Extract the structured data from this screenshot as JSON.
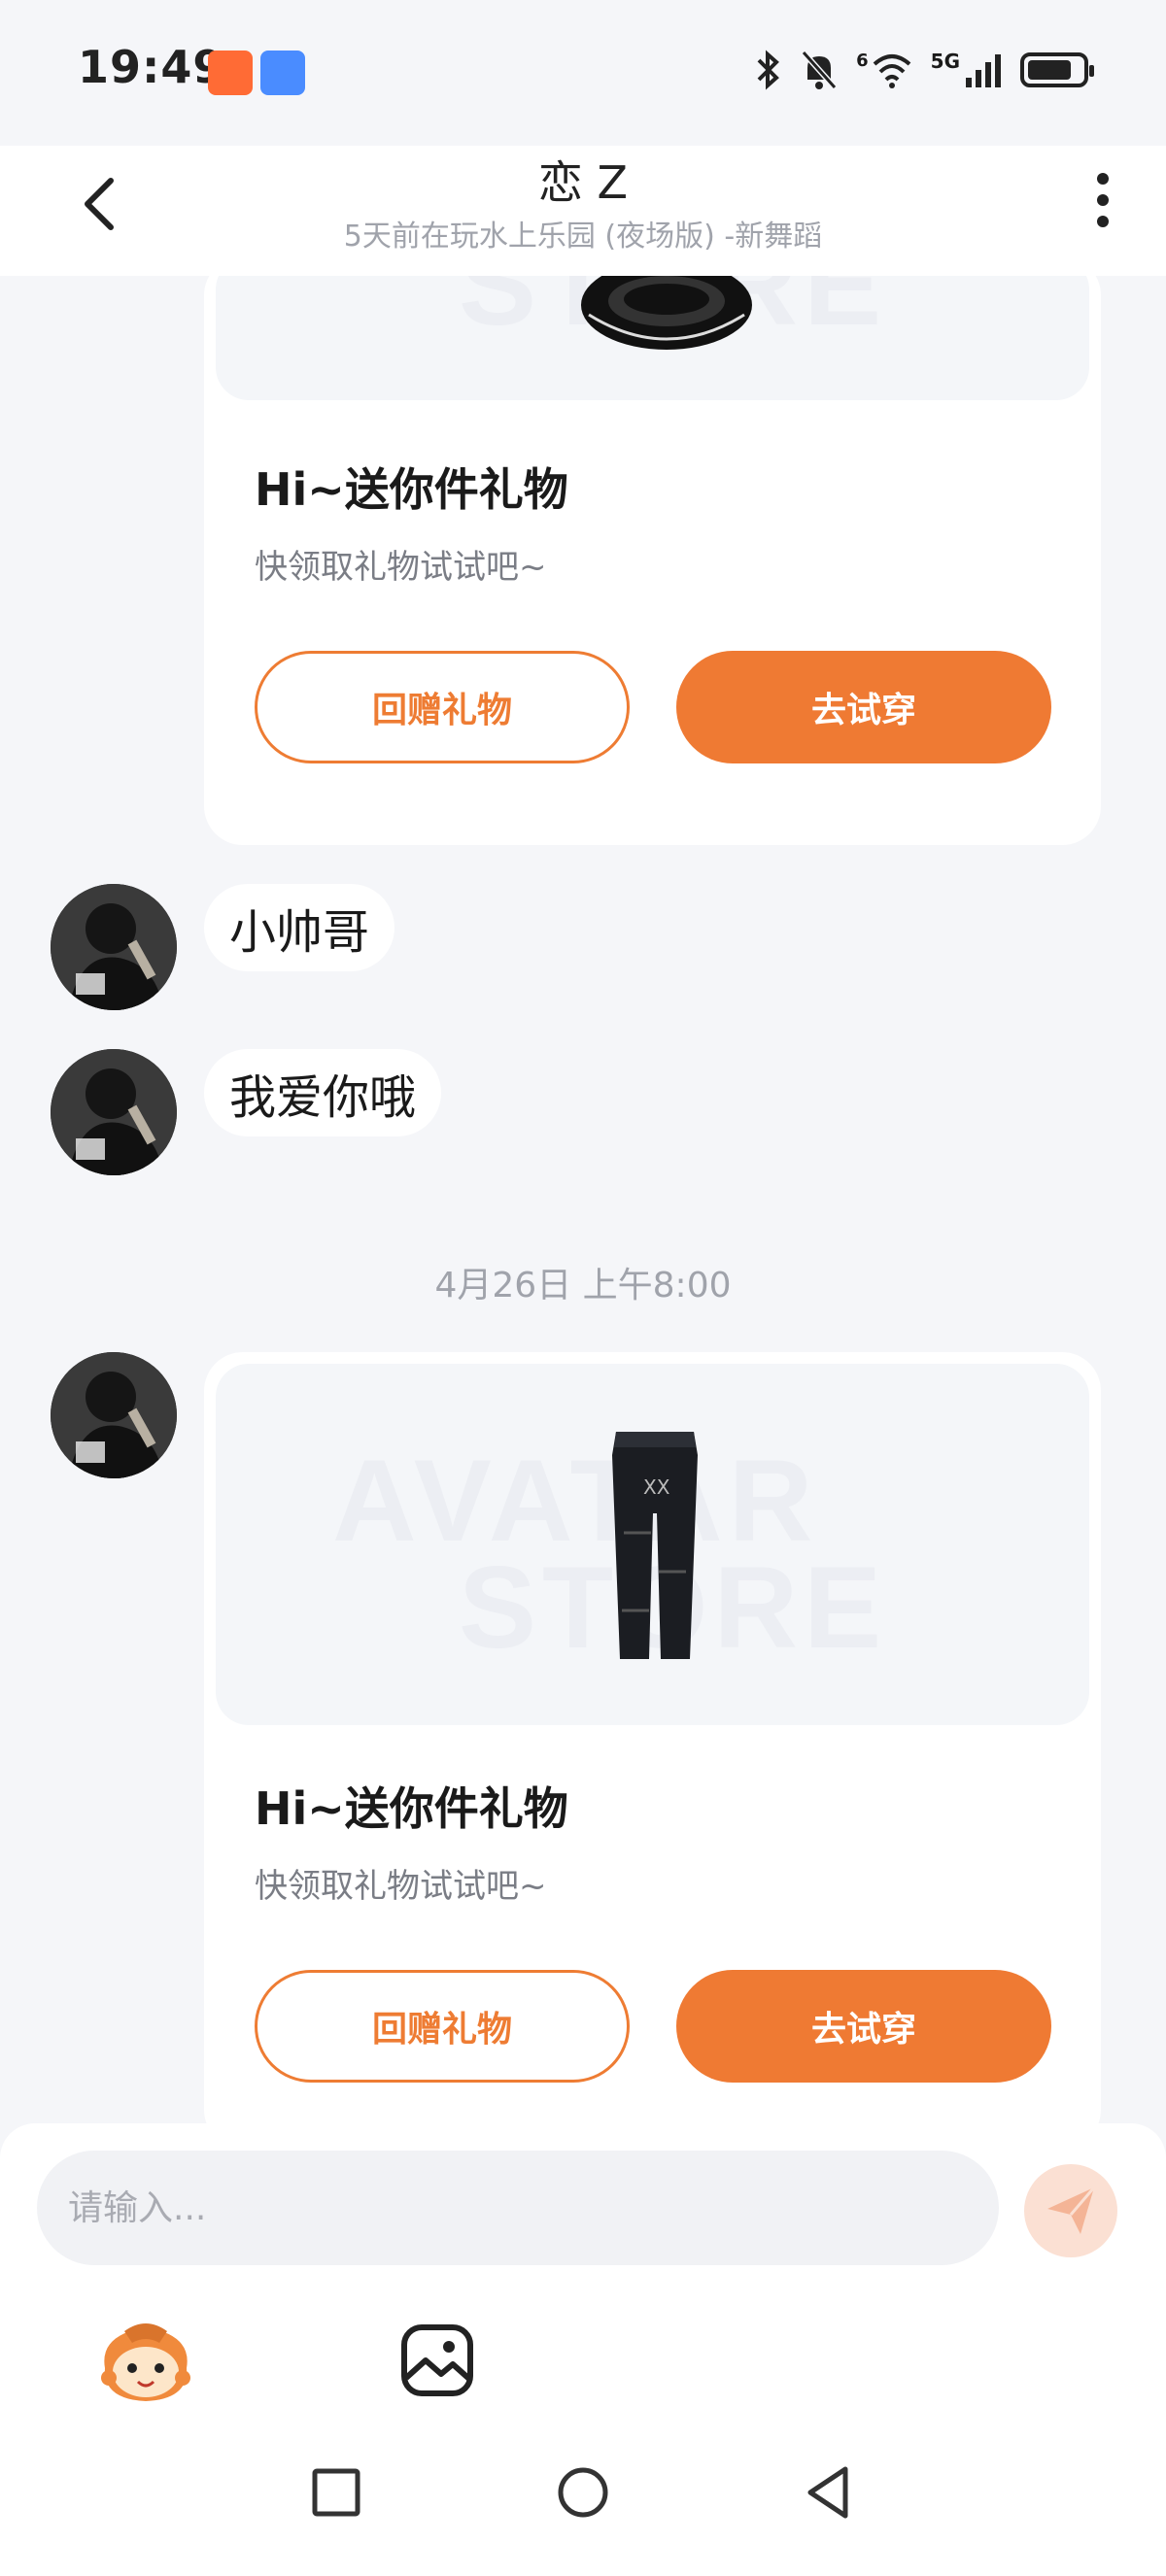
{
  "status_bar": {
    "time": "19:49",
    "signal_label": "5G",
    "sim_label": "6",
    "battery_level": 0.7
  },
  "header": {
    "name": "恋 Z",
    "subtitle": "5天前在玩水上乐园 (夜场版) -新舞蹈"
  },
  "watermark": {
    "line1": "AVATAR",
    "line2": "STORE"
  },
  "messages": {
    "card1": {
      "title": "Hi~送你件礼物",
      "subtitle": "快领取礼物试试吧~",
      "return_gift": "回赠礼物",
      "try_on": "去试穿"
    },
    "bubble1": "小帅哥",
    "bubble2": "我爱你哦",
    "timestamp": "4月26日 上午8:00",
    "card2": {
      "title": "Hi~送你件礼物",
      "subtitle": "快领取礼物试试吧~",
      "return_gift": "回赠礼物",
      "try_on": "去试穿"
    }
  },
  "input": {
    "placeholder": "请输入..."
  },
  "icons": {
    "back": "chevron-left-icon",
    "more": "more-vertical-icon",
    "send": "send-icon",
    "emoji": "emoji-avatar-icon",
    "image": "image-icon"
  },
  "colors": {
    "accent": "#ef7a33",
    "background": "#f5f6f9",
    "card": "#ffffff"
  }
}
